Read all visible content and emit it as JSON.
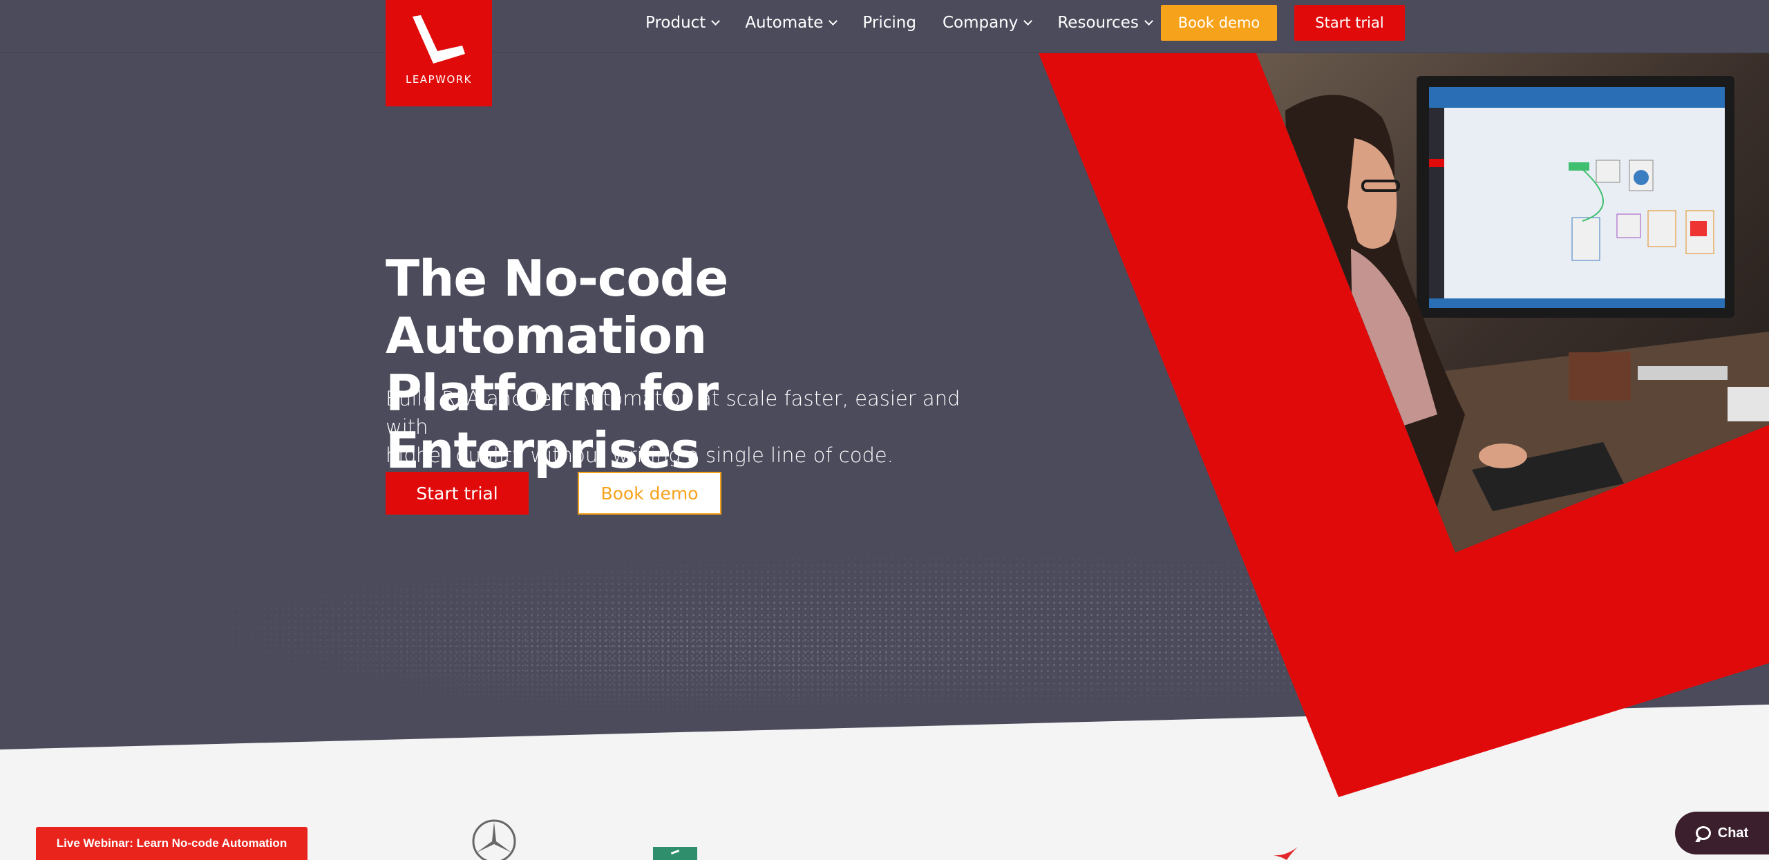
{
  "brand": {
    "name": "LEAPWORK",
    "red": "#e10a0a",
    "orange": "#f7a21b",
    "hero_bg": "#4b4b5c"
  },
  "nav": {
    "items": [
      {
        "label": "Product",
        "has_dropdown": true
      },
      {
        "label": "Automate",
        "has_dropdown": true
      },
      {
        "label": "Pricing",
        "has_dropdown": false
      },
      {
        "label": "Company",
        "has_dropdown": true
      },
      {
        "label": "Resources",
        "has_dropdown": true
      }
    ],
    "book_demo": "Book demo",
    "start_trial": "Start trial"
  },
  "hero": {
    "headline_line1": "The No-code Automation",
    "headline_line2": "Platform for Enterprises",
    "subline_line1": "Build RPA and Test Automation at scale faster, easier and with",
    "subline_line2": "higher quality without writing a single line of code.",
    "start_trial": "Start trial",
    "book_demo": "Book demo"
  },
  "webinar": {
    "label": "Live Webinar: Learn No-code Automation"
  },
  "chat": {
    "label": "Chat",
    "icon": "chat-bubble-icon"
  },
  "customer_logos": [
    "mercedes-benz-logo",
    "green-airline-logo",
    "red-bird-logo"
  ]
}
